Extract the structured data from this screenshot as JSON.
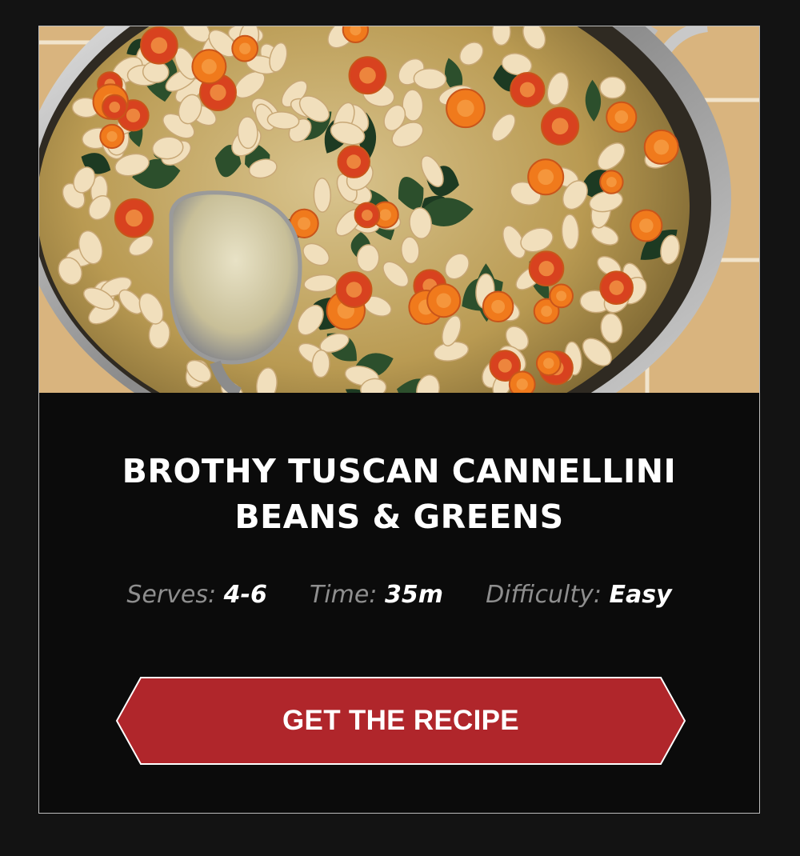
{
  "hero": {
    "image_icon": "soup-photo"
  },
  "recipe": {
    "title_line1": "BROTHY TUSCAN CANNELLINI",
    "title_line2": "BEANS & GREENS",
    "serves_label": "Serves:",
    "serves_value": "4-6",
    "time_label": "Time:",
    "time_value": "35m",
    "difficulty_label": "Difficulty:",
    "difficulty_value": "Easy"
  },
  "cta": {
    "label": "GET THE RECIPE"
  },
  "colors": {
    "page_background": "#131313",
    "card_background": "#0b0b0b",
    "card_border": "#bdbdbd",
    "button_fill": "#b0262b",
    "button_border": "#ffffff",
    "meta_label": "#8e8e8e",
    "meta_value": "#ffffff"
  }
}
